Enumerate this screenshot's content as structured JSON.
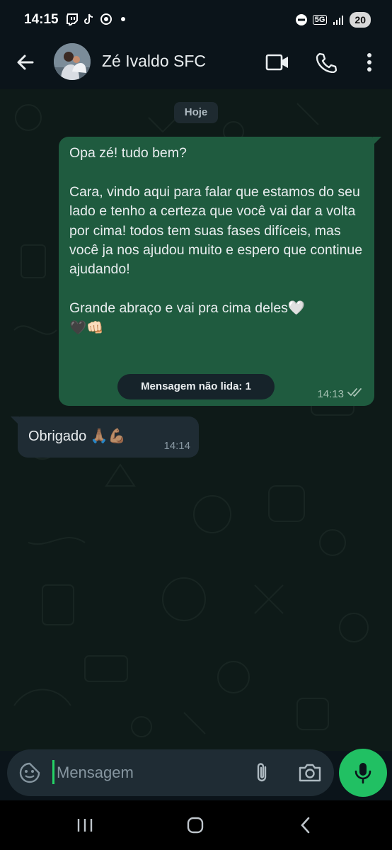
{
  "status_bar": {
    "time": "14:15",
    "network": "5G",
    "battery": "20"
  },
  "header": {
    "contact_name": "Zé Ivaldo SFC"
  },
  "chat": {
    "date_chip": "Hoje",
    "outgoing": {
      "text": "Opa zé! tudo bem?\n\nCara, vindo aqui para falar que estamos do seu lado e tenho a certeza que você vai dar a volta por cima! todos tem suas fases difíceis, mas você ja nos ajudou muito e espero que continue ajudando!\n\nGrande abraço e vai pra cima deles🤍\n🖤👊🏻",
      "time": "14:13"
    },
    "unread_divider": "Mensagem não lida: 1",
    "incoming": {
      "text": "Obrigado 🙏🏽💪🏽",
      "time": "14:14"
    }
  },
  "composer": {
    "placeholder": "Mensagem"
  },
  "colors": {
    "accent": "#21c063",
    "outgoing_bubble": "#1f5b3f",
    "incoming_bubble": "#1f2c34",
    "background": "#0b141a"
  },
  "icons": [
    "back-arrow-icon",
    "video-call-icon",
    "phone-icon",
    "more-options-icon",
    "sticker-icon",
    "attach-icon",
    "camera-icon",
    "mic-icon",
    "nav-recents-icon",
    "nav-home-icon",
    "nav-back-icon"
  ]
}
